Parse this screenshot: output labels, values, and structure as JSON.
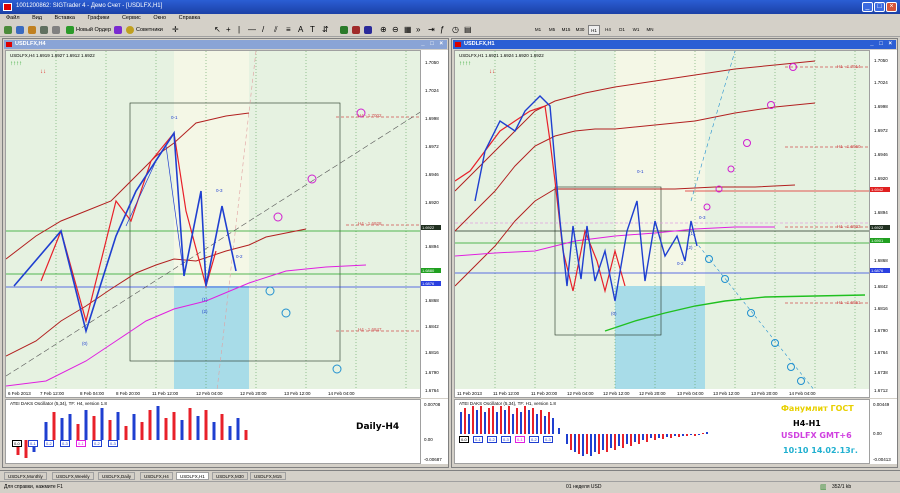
{
  "app": {
    "title": "1001200862: SIGTrader 4 - Демо Счет - [USDLFX,H1]"
  },
  "menu": [
    "Файл",
    "Вид",
    "Вставка",
    "Графики",
    "Сервис",
    "Окно",
    "Справка"
  ],
  "toolbar": {
    "new_order": "Новый Ордер",
    "advisors": "Советники",
    "timeframes": [
      "M1",
      "M5",
      "M15",
      "M30",
      "H1",
      "H4",
      "D1",
      "W1",
      "MN"
    ],
    "active_timeframe": "H1"
  },
  "left_chart": {
    "window_title": "USDLFX,H4",
    "header": "USDLFX,H4  1.6919 1.6927 1.6912 1.6922",
    "price_labels": [
      "1.7050",
      "1.7024",
      "1.6998",
      "1.6972",
      "1.6946",
      "1.6920",
      "1.6894",
      "1.6868",
      "1.6842",
      "1.6816",
      "1.6790",
      "1.6764"
    ],
    "current_price": "1.6922",
    "blue_price": "1.6876",
    "green_price": "1.6880",
    "time_labels": [
      "6 Feb 2013",
      "7 Feb 12:00",
      "8 Feb 04:00",
      "8 Feb 20:00",
      "11 Feb 12:00",
      "12 Feb 04:00",
      "12 Feb 20:00",
      "13 Feb 12:00",
      "14 Feb 04:00"
    ],
    "wave_labels": [
      "0-1",
      "0-2",
      "0-3",
      "(0)",
      "(1)",
      "(2)"
    ],
    "level_labels": [
      "H4 - 1.7002",
      "H4 - 1.6928",
      "H4 - 1.6847"
    ],
    "oscillator_title": "ATEI DAKS Oscillator (5,34), TF: H4, version 1.8",
    "oscillator_scale": [
      "0.00708",
      "0.00",
      "-0.00687"
    ],
    "oscillator_boxes": [
      "0-0",
      "0-1",
      "0-2",
      "0-3",
      "0-1",
      "0-2",
      "0-3"
    ],
    "overlay_label": "Daily-H4"
  },
  "right_chart": {
    "window_title": "USDLFX,H1",
    "header": "USDLFX,H1  1.6921 1.6924 1.6920 1.6922",
    "price_labels": [
      "1.7050",
      "1.7024",
      "1.6998",
      "1.6972",
      "1.6946",
      "1.6920",
      "1.6894",
      "1.6868",
      "1.6842",
      "1.6816",
      "1.6790",
      "1.6764",
      "1.6738",
      "1.6712"
    ],
    "current_price": "1.6922",
    "red_price": "1.6942",
    "green_price": "1.6901",
    "blue_price": "1.6876",
    "time_labels": [
      "11 Feb 2013",
      "11 Feb 12:00",
      "11 Feb 20:00",
      "12 Feb 04:00",
      "12 Feb 12:00",
      "12 Feb 20:00",
      "13 Feb 04:00",
      "13 Feb 12:00",
      "13 Feb 20:00",
      "14 Feb 04:00"
    ],
    "wave_labels": [
      "0-1",
      "0-2",
      "0-3",
      "(0)",
      "(1)",
      "(2)"
    ],
    "level_labels": [
      "H1 - 1.7014",
      "H1 - 1.6960",
      "H1 - 1.6923",
      "H1 - 1.6851"
    ],
    "oscillator_title": "ATEI DAKS Oscillator (5,34), TF: H1, version 1.8",
    "oscillator_scale": [
      "0.00449",
      "0.00",
      "-0.00413"
    ],
    "oscillator_boxes": [
      "0-0",
      "0-1",
      "0-2",
      "0-3",
      "0-1",
      "0-2",
      "0-3"
    ],
    "info": {
      "line1": "Фанумлит ГОСТ",
      "line2": "H4-H1",
      "line3": "USDLFX GMT+6",
      "line4": "10:10 14.02.13г."
    }
  },
  "tabs": [
    "USDLFX,Monthly",
    "USDLFX,Weekly",
    "USDLFX,Daily",
    "USDLFX,H4",
    "USDLFX,H1",
    "USDLFX,M30",
    "USDLFX,M15"
  ],
  "active_tab": "USDLFX,H1",
  "status": {
    "help": "Для справки, нажмите F1",
    "profile": "01 неделя USD",
    "traffic": "352/1 kb"
  },
  "colors": {
    "plot_bg": "#e6f2e1",
    "bull": "#1f3fd0",
    "bear": "#e8202a",
    "envelope": "#b22020",
    "magenta": "#e020e0",
    "osc_blue": "#1f3fd0",
    "osc_red": "#e8202a",
    "info_yellow": "#e8d000",
    "info_magenta": "#d040e0",
    "info_cyan": "#20b0d0"
  }
}
